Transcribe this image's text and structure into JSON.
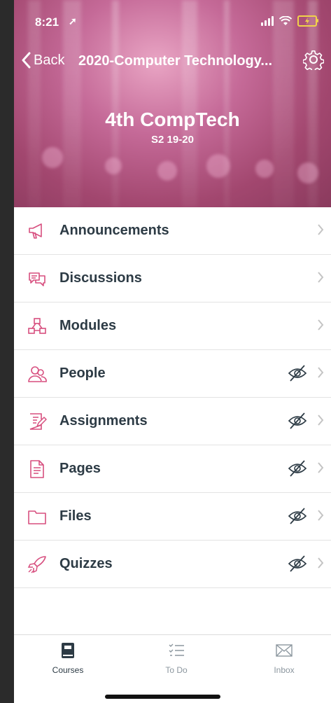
{
  "status_bar": {
    "time": "8:21"
  },
  "nav": {
    "back_label": "Back",
    "title": "2020-Computer Technology..."
  },
  "course": {
    "name": "4th CompTech",
    "term": "S2 19-20"
  },
  "menu": [
    {
      "label": "Announcements",
      "icon": "megaphone-icon",
      "hidden": false
    },
    {
      "label": "Discussions",
      "icon": "chat-bubbles-icon",
      "hidden": false
    },
    {
      "label": "Modules",
      "icon": "modules-icon",
      "hidden": false
    },
    {
      "label": "People",
      "icon": "people-icon",
      "hidden": true
    },
    {
      "label": "Assignments",
      "icon": "assignment-icon",
      "hidden": true
    },
    {
      "label": "Pages",
      "icon": "document-icon",
      "hidden": true
    },
    {
      "label": "Files",
      "icon": "folder-icon",
      "hidden": true
    },
    {
      "label": "Quizzes",
      "icon": "rocket-icon",
      "hidden": true
    }
  ],
  "tabs": [
    {
      "label": "Courses",
      "active": true
    },
    {
      "label": "To Do",
      "active": false
    },
    {
      "label": "Inbox",
      "active": false
    }
  ],
  "colors": {
    "accent": "#d74f7f",
    "text": "#2d3b45",
    "tab_inactive": "#8b969e",
    "battery": "#f0d24a"
  }
}
